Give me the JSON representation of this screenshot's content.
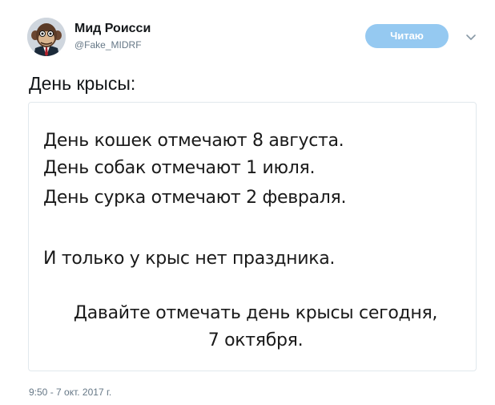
{
  "author": {
    "name": "Мид Роисси",
    "handle": "@Fake_MIDRF"
  },
  "follow_button": {
    "label": "Читаю"
  },
  "tweet": {
    "text": "День крысы:",
    "image_lines": [
      "День кошек отмечают 8 августа.",
      "День собак отмечают 1 июля.",
      "День сурка отмечают 2 февраля.",
      "И только у крыс нет праздника.",
      "Давайте отмечать день крысы сегодня,",
      "7 октября."
    ],
    "timestamp": "9:50 - 7 окт. 2017 г."
  },
  "colors": {
    "follow_button_bg": "#95c9f1",
    "secondary_text": "#657786",
    "border": "#e1e8ed"
  },
  "icons": {
    "avatar": "cartoon-chimp-avatar-icon",
    "menu": "chevron-down-icon"
  }
}
